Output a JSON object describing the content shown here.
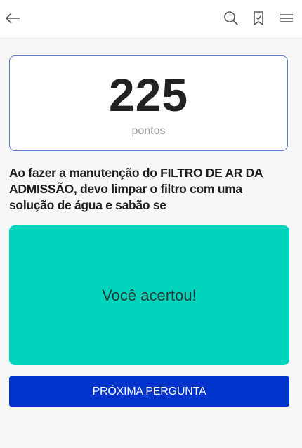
{
  "topbar": {
    "back_icon": "arrow-left-icon",
    "search_icon": "search-icon",
    "bookmark_icon": "bookmark-check-icon",
    "menu_icon": "hamburger-menu-icon"
  },
  "score": {
    "value": "225",
    "label": "pontos"
  },
  "question": {
    "text": "Ao fazer a manutenção do FILTRO DE AR DA ADMISSÃO, devo limpar o filtro com uma solução de água e sabão se"
  },
  "feedback": {
    "text": "Você acertou!",
    "color": "#00d4bd"
  },
  "next_button": {
    "label": "PRÓXIMA PERGUNTA",
    "color": "#0033cc"
  },
  "colors": {
    "accent": "#0033cc",
    "card_border": "#5a7ad6",
    "background": "#f7f7f7"
  }
}
